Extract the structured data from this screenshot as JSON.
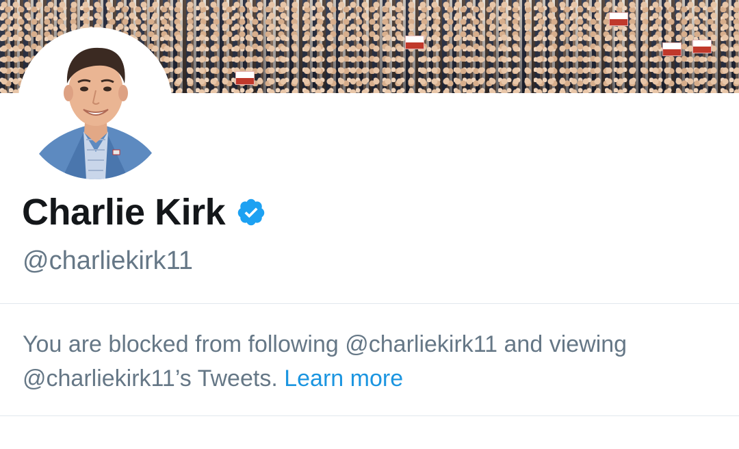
{
  "profile": {
    "display_name": "Charlie Kirk",
    "handle": "@charliekirk11",
    "verified": true,
    "verified_icon": "verified-badge-icon"
  },
  "notice": {
    "text_prefix": "You are blocked from following @charliekirk11 and viewing @charliekirk11’s Tweets.",
    "link_text": "Learn more"
  },
  "colors": {
    "name": "#14171a",
    "secondary": "#657786",
    "link": "#1b95e0",
    "verified": "#1da1f2",
    "divider": "#e1e8ed"
  }
}
